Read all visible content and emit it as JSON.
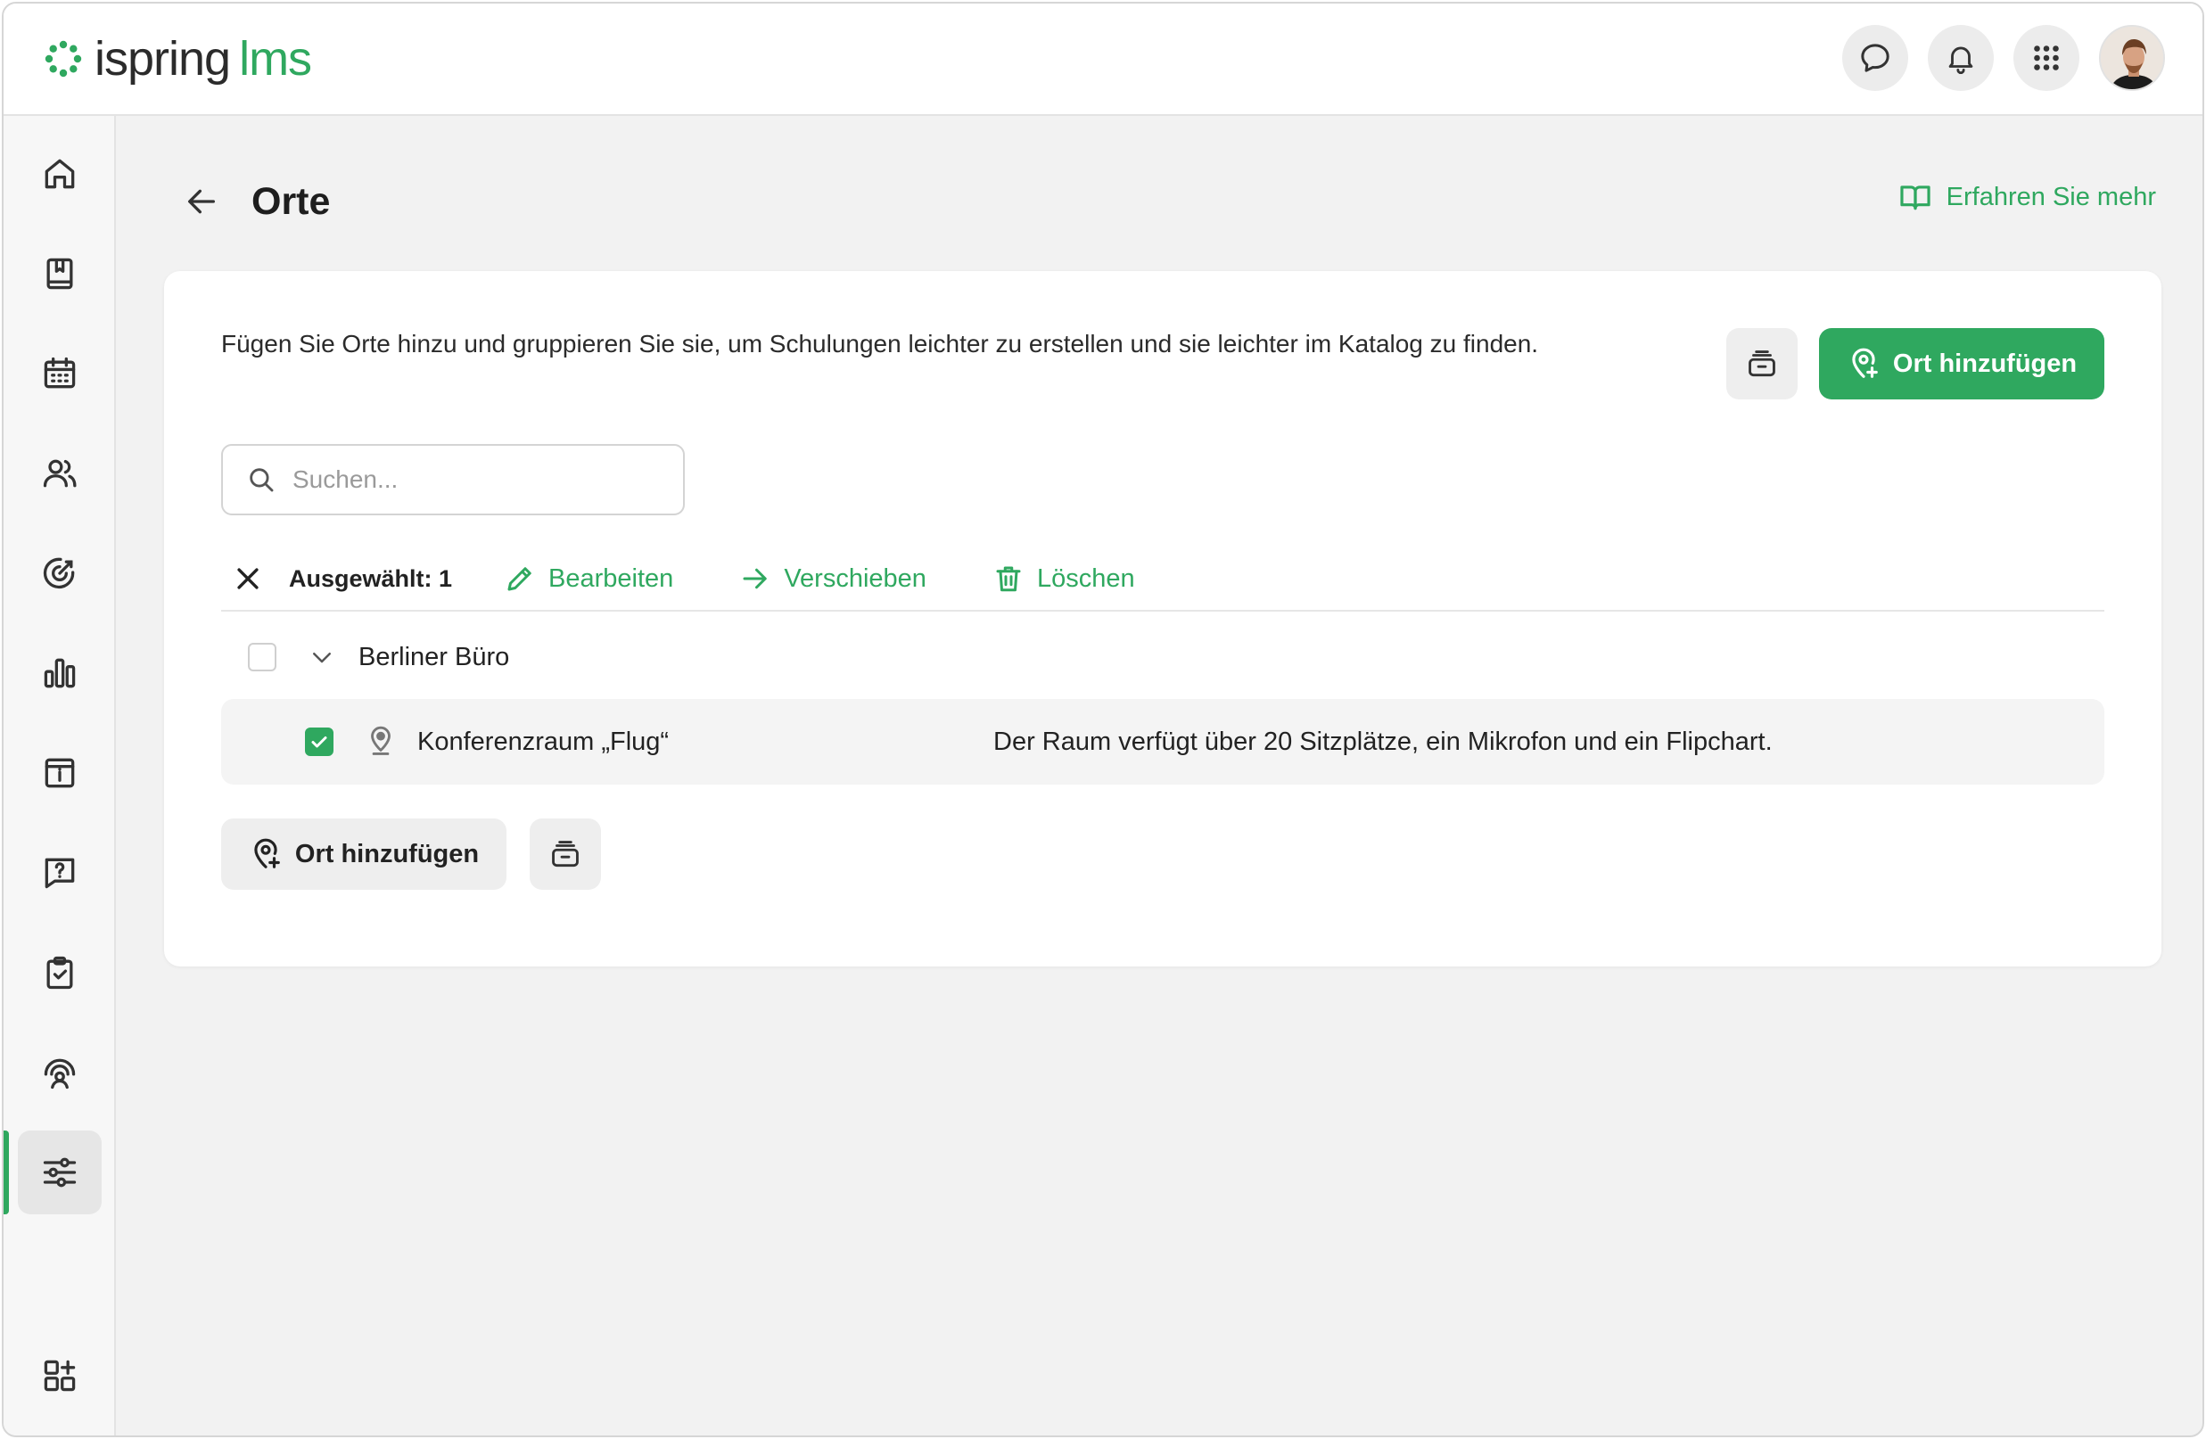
{
  "app": {
    "logo_main": "ispring",
    "logo_accent": "lms"
  },
  "header": {
    "actions": [
      "chat-icon",
      "bell-icon",
      "apps-grid-icon"
    ],
    "avatar": "user-avatar"
  },
  "sidebar": {
    "items": [
      {
        "icon": "home-icon"
      },
      {
        "icon": "courses-book-icon"
      },
      {
        "icon": "calendar-icon"
      },
      {
        "icon": "users-icon"
      },
      {
        "icon": "target-icon"
      },
      {
        "icon": "reports-chart-icon"
      },
      {
        "icon": "info-archive-icon"
      },
      {
        "icon": "question-chat-icon"
      },
      {
        "icon": "clipboard-check-icon"
      },
      {
        "icon": "coaching-icon"
      },
      {
        "icon": "settings-sliders-icon",
        "active": true
      }
    ],
    "bottom_icon": "add-widget-icon"
  },
  "page": {
    "title": "Orte",
    "learn_more": "Erfahren Sie mehr"
  },
  "card": {
    "description": "Fügen Sie Orte hinzu und gruppieren Sie sie, um Schulungen leichter zu erstellen und sie leichter im Katalog zu finden.",
    "add_location_label": "Ort hinzufügen",
    "search": {
      "placeholder": "Suchen...",
      "value": ""
    },
    "toolbar": {
      "selected_label": "Ausgewählt: 1",
      "edit_label": "Bearbeiten",
      "move_label": "Verschieben",
      "delete_label": "Löschen"
    },
    "group": {
      "name": "Berliner Büro",
      "checked": false
    },
    "locations": [
      {
        "name": "Konferenzraum „Flug“",
        "description": "Der Raum verfügt über 20 Sitzplätze, ein Mikrofon und ein Flipchart.",
        "checked": true
      }
    ],
    "bottom_add_label": "Ort hinzufügen"
  },
  "colors": {
    "accent": "#2fa85f",
    "background": "#f2f2f2",
    "card": "#ffffff",
    "text": "#222222"
  }
}
